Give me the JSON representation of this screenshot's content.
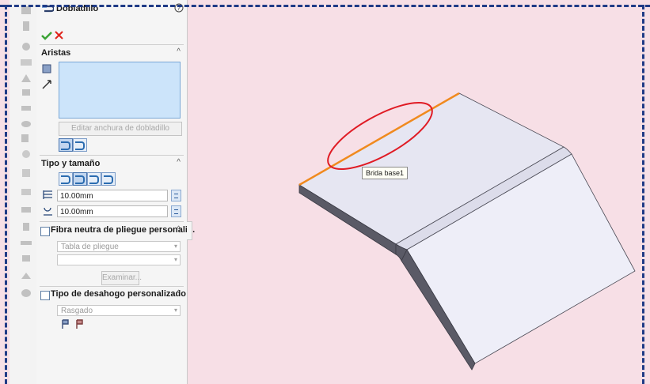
{
  "panel": {
    "title": "Dobladillo",
    "help_icon": "question-circle-icon",
    "confirm_icon": "check-icon",
    "cancel_icon": "close-icon"
  },
  "aristas": {
    "title": "Aristas",
    "edit_width_button": "Editar anchura de dobladillo"
  },
  "tipo_tamano": {
    "title": "Tipo y tamaño",
    "length_value": "10.00mm",
    "gap_value": "10.00mm"
  },
  "fibra_neutra": {
    "title": "Fibra neutra de pliegue personali...",
    "table_dropdown": "Tabla de pliegue",
    "second_dropdown": "",
    "browse_button": "Examinar..."
  },
  "desahogo": {
    "title": "Tipo de desahogo personalizado",
    "dropdown": "Rasgado"
  },
  "viewport": {
    "tooltip": "Brida base1"
  },
  "colors": {
    "selected_edge": "#f08a1e",
    "highlight_ellipse": "#e01b24",
    "part_face": "#e6e6f2",
    "frame_dash": "#1f3b86"
  }
}
